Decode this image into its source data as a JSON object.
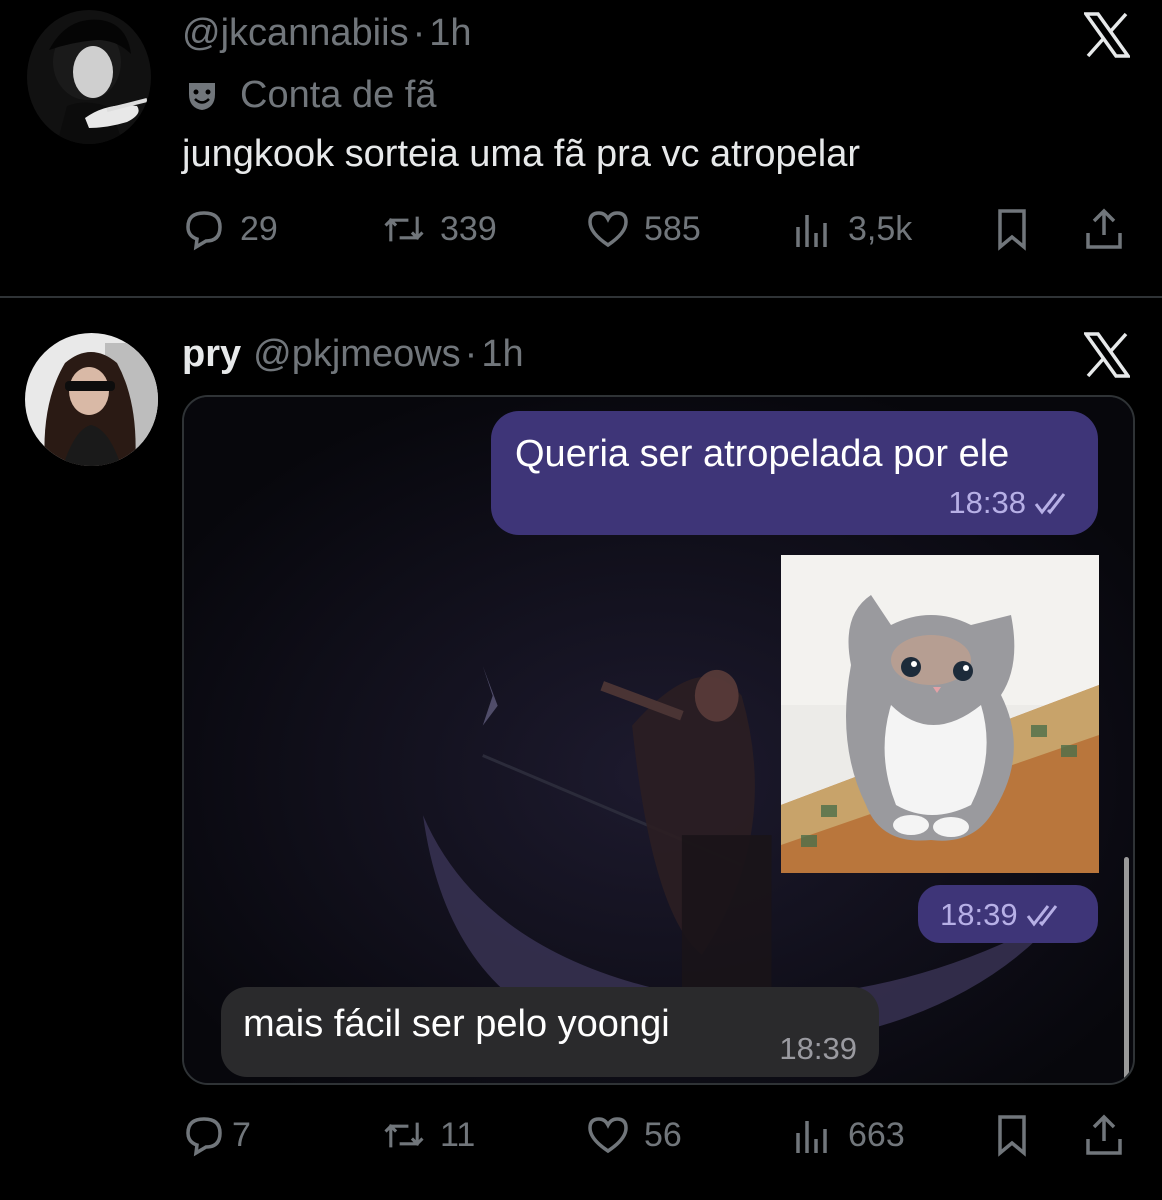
{
  "tweets": [
    {
      "display_name": "",
      "handle": "@jkcannabiis",
      "sep": "·",
      "time": "1h",
      "label": "Conta de fã",
      "text": "jungkook sorteia uma fã pra vc atropelar",
      "actions": {
        "replies": "29",
        "reposts": "339",
        "likes": "585",
        "views": "3,5k"
      }
    },
    {
      "display_name": "pry",
      "handle": "@pkjmeows",
      "sep": "·",
      "time": "1h",
      "text": "",
      "media": {
        "messages": [
          {
            "text": "Queria ser atropelada por ele",
            "time": "18:38",
            "direction": "outgoing"
          },
          {
            "text": "",
            "time": "18:39",
            "direction": "outgoing",
            "attachment": "kitten-photo"
          },
          {
            "text": "mais fácil ser pelo yoongi",
            "time": "18:39",
            "direction": "incoming"
          }
        ]
      },
      "actions": {
        "replies": "7",
        "reposts": "11",
        "likes": "56",
        "views": "663"
      }
    }
  ],
  "colors": {
    "background": "#000000",
    "text": "#e7e9ea",
    "muted": "#71767b",
    "outgoing_bubble": "#3e3578",
    "incoming_bubble": "#2a2a2c"
  }
}
